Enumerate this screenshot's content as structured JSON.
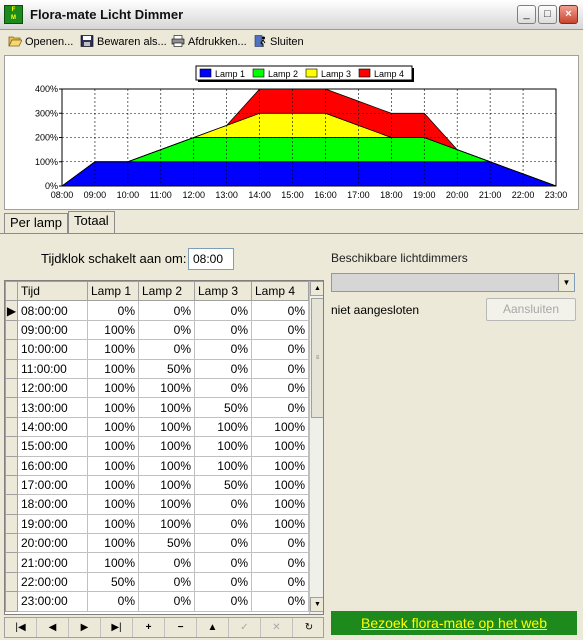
{
  "window": {
    "title": "Flora-mate Licht Dimmer",
    "icon_text": "Flora-mate",
    "buttons": {
      "minimize": "_",
      "maximize": "□",
      "close": "×"
    }
  },
  "toolbar": {
    "items": [
      {
        "label": "Openen...",
        "icon": "folder-open-icon"
      },
      {
        "label": "Bewaren als...",
        "icon": "floppy-disk-icon"
      },
      {
        "label": "Afdrukken...",
        "icon": "printer-icon"
      },
      {
        "label": "Sluiten",
        "icon": "exit-icon"
      }
    ]
  },
  "chart_data": {
    "type": "area",
    "stacked": true,
    "x": [
      "08:00",
      "09:00",
      "10:00",
      "11:00",
      "12:00",
      "13:00",
      "14:00",
      "15:00",
      "16:00",
      "17:00",
      "18:00",
      "19:00",
      "20:00",
      "21:00",
      "22:00",
      "23:00"
    ],
    "series": [
      {
        "name": "Lamp 1",
        "color": "#0000ff",
        "values": [
          0,
          100,
          100,
          100,
          100,
          100,
          100,
          100,
          100,
          100,
          100,
          100,
          100,
          100,
          50,
          0
        ]
      },
      {
        "name": "Lamp 2",
        "color": "#00ff00",
        "values": [
          0,
          0,
          0,
          50,
          100,
          100,
          100,
          100,
          100,
          100,
          100,
          100,
          50,
          0,
          0,
          0
        ]
      },
      {
        "name": "Lamp 3",
        "color": "#ffff00",
        "values": [
          0,
          0,
          0,
          0,
          0,
          50,
          100,
          100,
          100,
          50,
          0,
          0,
          0,
          0,
          0,
          0
        ]
      },
      {
        "name": "Lamp 4",
        "color": "#ff0000",
        "values": [
          0,
          0,
          0,
          0,
          0,
          0,
          100,
          100,
          100,
          100,
          100,
          100,
          0,
          0,
          0,
          0
        ]
      }
    ],
    "y_ticks": [
      "0%",
      "100%",
      "200%",
      "300%",
      "400%"
    ],
    "ylim": [
      0,
      400
    ],
    "legend": "top",
    "grid": true
  },
  "tabs": [
    {
      "label": "Per lamp",
      "active": false
    },
    {
      "label": "Totaal",
      "active": true
    }
  ],
  "clock": {
    "label": "Tijdklok schakelt aan om:",
    "value": "08:00"
  },
  "grid": {
    "columns": [
      "Tijd",
      "Lamp 1",
      "Lamp 2",
      "Lamp 3",
      "Lamp 4"
    ],
    "rows": [
      [
        "08:00:00",
        "0%",
        "0%",
        "0%",
        "0%"
      ],
      [
        "09:00:00",
        "100%",
        "0%",
        "0%",
        "0%"
      ],
      [
        "10:00:00",
        "100%",
        "0%",
        "0%",
        "0%"
      ],
      [
        "11:00:00",
        "100%",
        "50%",
        "0%",
        "0%"
      ],
      [
        "12:00:00",
        "100%",
        "100%",
        "0%",
        "0%"
      ],
      [
        "13:00:00",
        "100%",
        "100%",
        "50%",
        "0%"
      ],
      [
        "14:00:00",
        "100%",
        "100%",
        "100%",
        "100%"
      ],
      [
        "15:00:00",
        "100%",
        "100%",
        "100%",
        "100%"
      ],
      [
        "16:00:00",
        "100%",
        "100%",
        "100%",
        "100%"
      ],
      [
        "17:00:00",
        "100%",
        "100%",
        "50%",
        "100%"
      ],
      [
        "18:00:00",
        "100%",
        "100%",
        "0%",
        "100%"
      ],
      [
        "19:00:00",
        "100%",
        "100%",
        "0%",
        "100%"
      ],
      [
        "20:00:00",
        "100%",
        "50%",
        "0%",
        "0%"
      ],
      [
        "21:00:00",
        "100%",
        "0%",
        "0%",
        "0%"
      ],
      [
        "22:00:00",
        "50%",
        "0%",
        "0%",
        "0%"
      ],
      [
        "23:00:00",
        "0%",
        "0%",
        "0%",
        "0%"
      ]
    ],
    "current_row_marker": "▶"
  },
  "navigator": {
    "buttons": [
      {
        "name": "first-record-button",
        "glyph": "|◀",
        "enabled": true
      },
      {
        "name": "prior-record-button",
        "glyph": "◀",
        "enabled": true
      },
      {
        "name": "next-record-button",
        "glyph": "▶",
        "enabled": true
      },
      {
        "name": "last-record-button",
        "glyph": "▶|",
        "enabled": true
      },
      {
        "name": "insert-record-button",
        "glyph": "+",
        "enabled": true
      },
      {
        "name": "delete-record-button",
        "glyph": "−",
        "enabled": true
      },
      {
        "name": "edit-record-button",
        "glyph": "▲",
        "enabled": true
      },
      {
        "name": "post-record-button",
        "glyph": "✓",
        "enabled": false
      },
      {
        "name": "cancel-record-button",
        "glyph": "✕",
        "enabled": false
      },
      {
        "name": "refresh-record-button",
        "glyph": "↻",
        "enabled": true
      }
    ]
  },
  "dimmers": {
    "label": "Beschikbare lichtdimmers",
    "selected": "",
    "status": "niet aangesloten",
    "connect_label": "Aansluiten"
  },
  "web_link": "Bezoek flora-mate op het web"
}
